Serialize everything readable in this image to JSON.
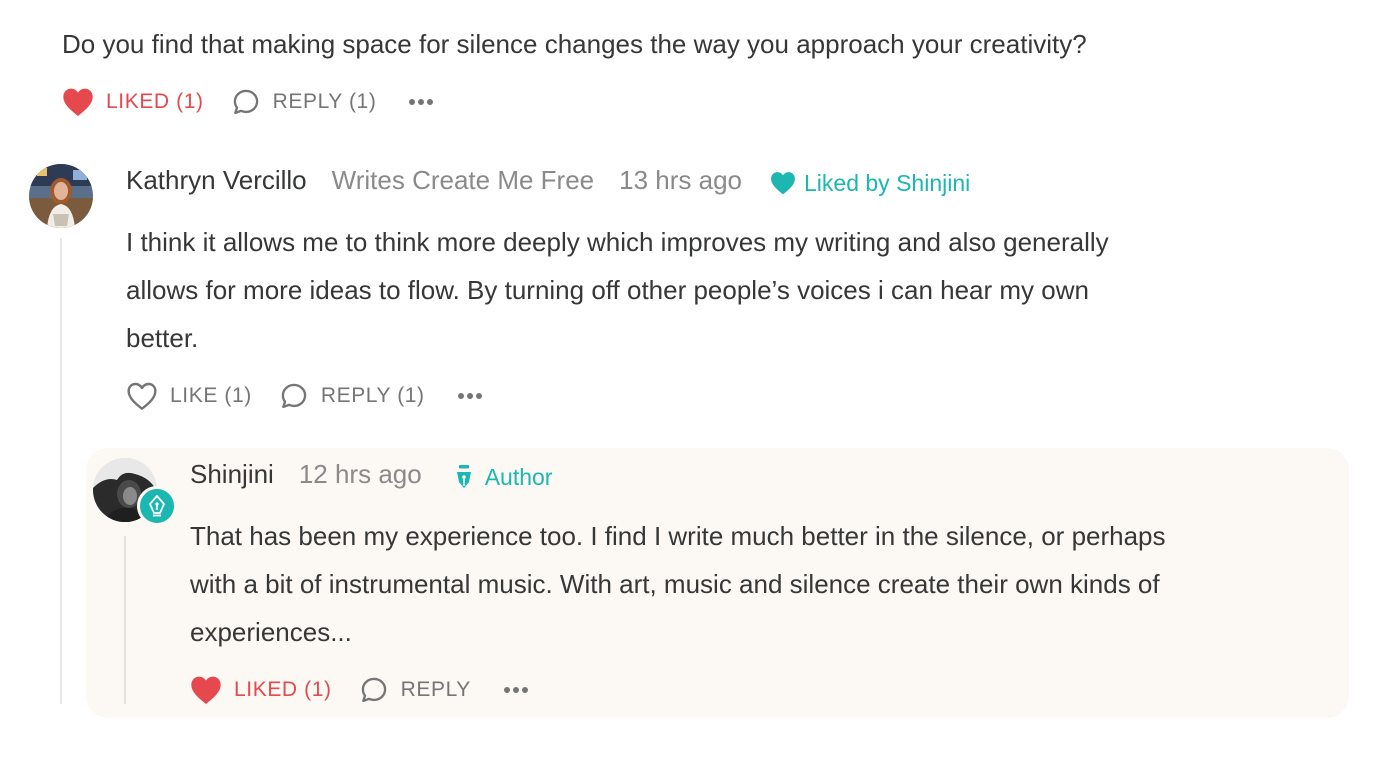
{
  "top_comment": {
    "text": "Do you find that making space for silence changes the way you approach your creativity?",
    "like_label": "LIKED (1)",
    "reply_label": "REPLY (1)"
  },
  "comment": {
    "author": "Kathryn Vercillo",
    "publication": "Writes Create Me Free",
    "time": "13 hrs ago",
    "liked_by": "Liked by Shinjini",
    "text_line1": "I think it allows me to think more deeply which improves my writing and also generally",
    "text_line2": "allows for more ideas to flow. By turning off other people’s voices i can hear my own",
    "text_line3": "better.",
    "like_label": "LIKE (1)",
    "reply_label": "REPLY (1)"
  },
  "reply": {
    "author": "Shinjini",
    "time": "12 hrs ago",
    "badge": "Author",
    "text_line1": "That has been my experience too. I find I write much better in the silence, or perhaps",
    "text_line2": "with a bit of instrumental music. With art, music and silence create their own kinds of",
    "text_line3": "experiences...",
    "like_label": "LIKED (1)",
    "reply_label": "REPLY"
  },
  "colors": {
    "liked": "#e5484d",
    "teal": "#1bb7b0",
    "muted": "#757575",
    "card_bg": "#fcf9f4"
  },
  "icons": [
    "heart-filled-icon",
    "heart-outline-icon",
    "comment-bubble-icon",
    "more-dots-icon",
    "pen-nib-icon"
  ]
}
